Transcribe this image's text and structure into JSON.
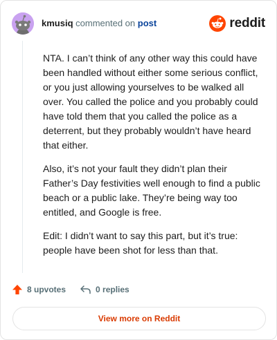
{
  "header": {
    "username": "kmusiq",
    "action_text": "commented on",
    "post_link": "post",
    "brand": "reddit"
  },
  "comment": {
    "paragraphs": [
      "NTA. I can’t think of any other way this could have been handled without either some serious conflict, or you just allowing yourselves to be walked all over. You called the police and you probably could have told them that you called the police as a deterrent, but they probably wouldn’t have heard that either.",
      "Also, it’s not your fault they didn’t plan their Father’s Day festivities well enough to find a public beach or a public lake. They’re being way too entitled, and Google is free.",
      "Edit: I didn’t want to say this part, but it’s true: people have been shot for less than that."
    ]
  },
  "footer": {
    "upvotes": "8 upvotes",
    "replies": "0 replies",
    "view_more": "View more on Reddit"
  },
  "colors": {
    "brand_orange": "#ff4500",
    "link_blue": "#0a449b",
    "muted": "#576f76",
    "cta": "#d93a00",
    "avatar_bg": "#c9a2f0"
  },
  "icons": {
    "avatar": "snoo-avatar-icon",
    "logo": "reddit-logo-icon",
    "upvote": "upvote-arrow-icon",
    "reply": "reply-arrow-icon"
  }
}
